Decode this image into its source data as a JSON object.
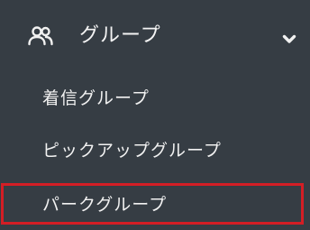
{
  "menu": {
    "group": {
      "label": "グループ",
      "icon": "users-icon",
      "toggle_icon": "chevron-down-icon",
      "expanded": true
    },
    "items": [
      {
        "label": "着信グループ"
      },
      {
        "label": "ピックアップグループ"
      },
      {
        "label": "パークグループ",
        "highlighted": true
      }
    ]
  },
  "colors": {
    "background": "#363d44",
    "text": "#f1f1f1",
    "highlight_border": "#d41e25"
  }
}
